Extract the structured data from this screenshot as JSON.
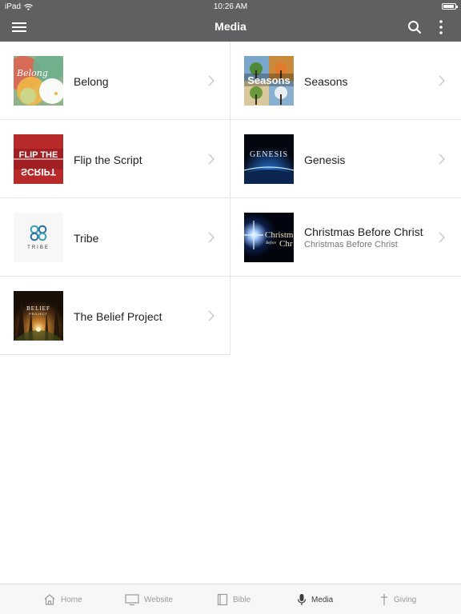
{
  "status": {
    "device": "iPad",
    "time": "10:26 AM",
    "battery_level": 0.9
  },
  "header": {
    "title": "Media"
  },
  "media_items": [
    {
      "title": "Belong",
      "subtitle": "",
      "thumb_icon": "belong-thumbnail-icon",
      "thumb_text": "Belong"
    },
    {
      "title": "Seasons",
      "subtitle": "",
      "thumb_icon": "seasons-thumbnail-icon",
      "thumb_text": "Seasons"
    },
    {
      "title": "Flip the Script",
      "subtitle": "",
      "thumb_icon": "flip-the-script-thumbnail-icon",
      "thumb_text": "FLIP THE",
      "thumb_text_2": "SCRIPT"
    },
    {
      "title": "Genesis",
      "subtitle": "",
      "thumb_icon": "genesis-thumbnail-icon",
      "thumb_text": "GENESIS"
    },
    {
      "title": "Tribe",
      "subtitle": "",
      "thumb_icon": "tribe-thumbnail-icon",
      "thumb_text": "TRIBE"
    },
    {
      "title": "Christmas Before Christ",
      "subtitle": "Christmas Before Christ",
      "thumb_icon": "christmas-thumbnail-icon",
      "thumb_text": "Christm",
      "thumb_text_2": "Before",
      "thumb_text_3": "Chr"
    },
    {
      "title": "The Belief Project",
      "subtitle": "",
      "thumb_icon": "belief-project-thumbnail-icon",
      "thumb_text": "BELIEF",
      "thumb_text_2": "PROJECT"
    }
  ],
  "tabs": [
    {
      "label": "Home",
      "icon": "home-icon",
      "active": false
    },
    {
      "label": "Website",
      "icon": "monitor-icon",
      "active": false
    },
    {
      "label": "Bible",
      "icon": "book-icon",
      "active": false
    },
    {
      "label": "Media",
      "icon": "microphone-icon",
      "active": true
    },
    {
      "label": "Giving",
      "icon": "cross-icon",
      "active": false
    }
  ],
  "colors": {
    "header_bg": "#5f6061",
    "divider": "#e4e4e4",
    "tab_inactive": "#9a9a9a",
    "tab_active": "#3c3c3c"
  }
}
